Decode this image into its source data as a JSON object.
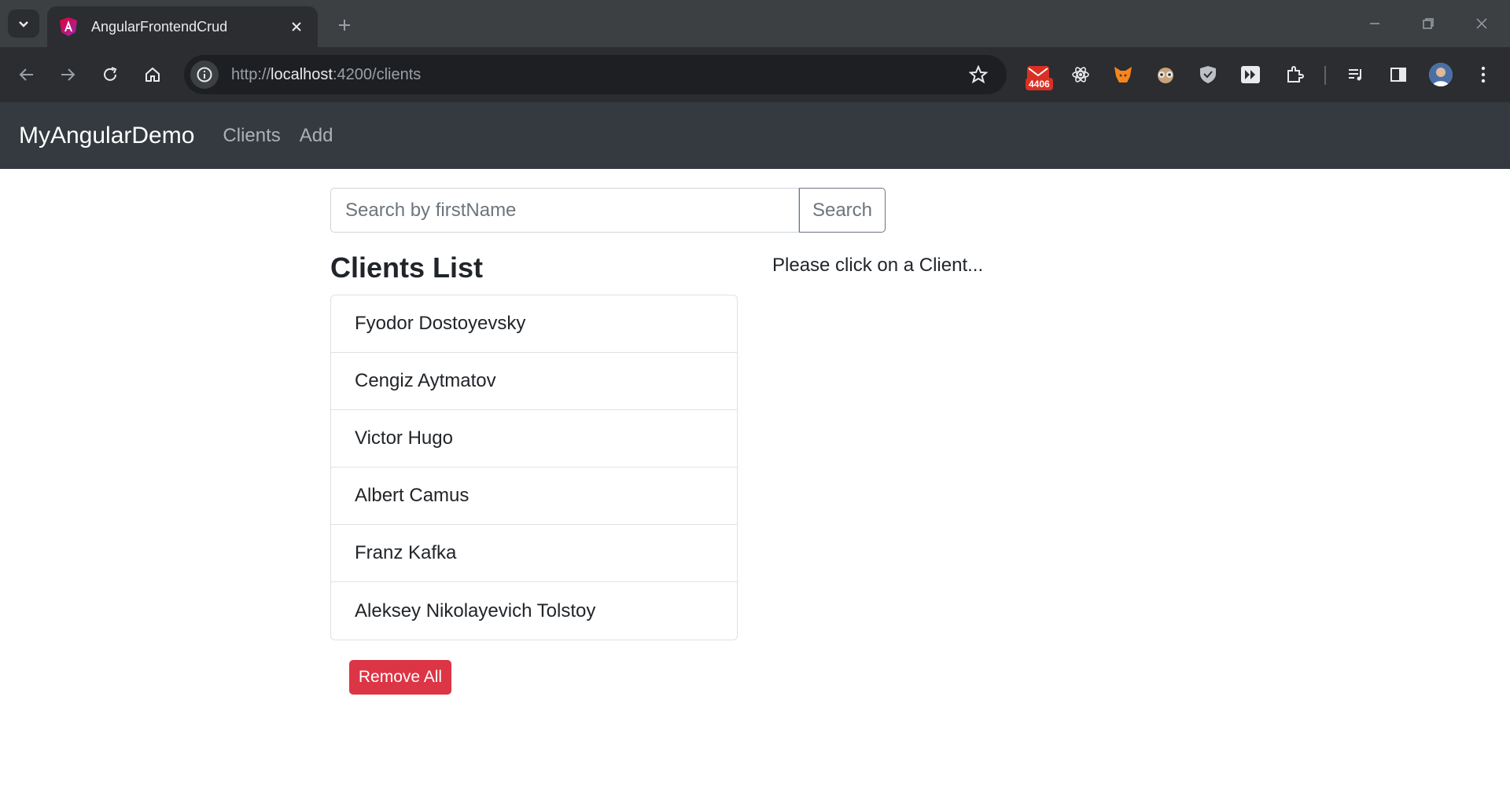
{
  "browser": {
    "tab_title": "AngularFrontendCrud",
    "url_scheme": "http://",
    "url_host": "localhost",
    "url_rest": ":4200/clients",
    "extension_badge": "4406",
    "icons": [
      "tab-search-icon",
      "angular-favicon",
      "close-icon",
      "new-tab-icon",
      "minimize-icon",
      "restore-icon",
      "window-close-icon",
      "back-icon",
      "forward-icon",
      "reload-icon",
      "home-icon",
      "site-info-icon",
      "star-icon",
      "gmail-extension-icon",
      "react-devtools-icon",
      "metamask-icon",
      "spy-extension-icon",
      "shield-extension-icon",
      "fast-forward-extension-icon",
      "extensions-icon",
      "reading-list-icon",
      "side-panel-icon",
      "profile-avatar",
      "menu-icon"
    ]
  },
  "navbar": {
    "brand": "MyAngularDemo",
    "links": [
      "Clients",
      "Add"
    ]
  },
  "search": {
    "placeholder": "Search by firstName",
    "button_label": "Search"
  },
  "clients": {
    "title": "Clients List",
    "items": [
      "Fyodor Dostoyevsky",
      "Cengiz Aytmatov",
      "Victor Hugo",
      "Albert Camus",
      "Franz Kafka",
      "Aleksey Nikolayevich Tolstoy"
    ],
    "remove_all_label": "Remove All"
  },
  "detail": {
    "hint": "Please click on a Client..."
  },
  "colors": {
    "navbar_bg": "#343a40",
    "danger": "#dc3545",
    "chrome_dark": "#2b2d30"
  }
}
